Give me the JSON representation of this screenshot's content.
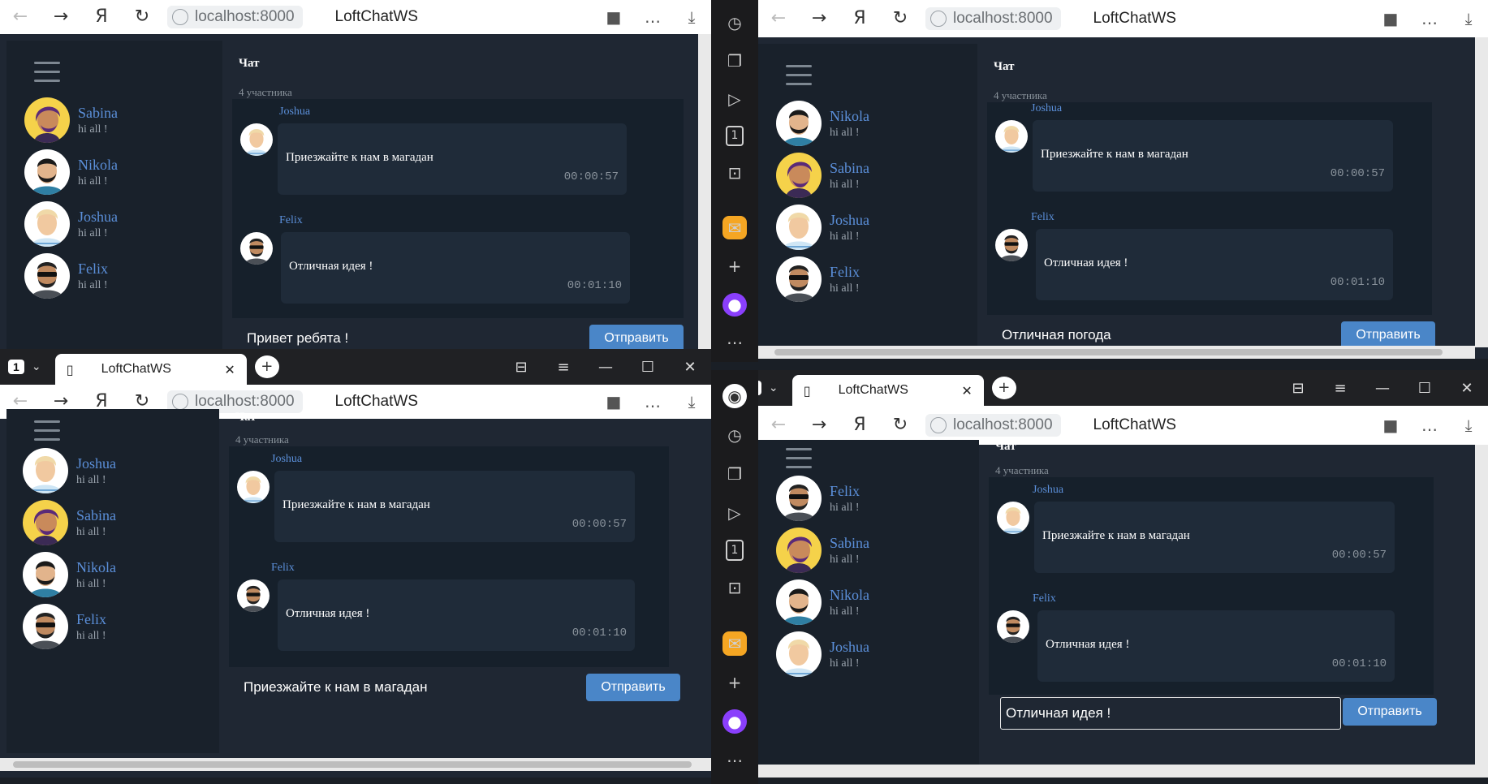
{
  "browser": {
    "address": "localhost:8000",
    "page_title": "LoftChatWS",
    "tab_title": "LoftChatWS",
    "tab_count": "1"
  },
  "chat": {
    "title": "Чат",
    "members_count": "4 участника",
    "send_label": "Отправить",
    "user_last_message": "hi all !",
    "messages": [
      {
        "author": "Joshua",
        "text": "Приезжайте к нам в магадан",
        "time": "00:00:57"
      },
      {
        "author": "Felix",
        "text": "Отличная идея !",
        "time": "00:01:10"
      }
    ]
  },
  "windows": [
    {
      "users": [
        "Sabina",
        "Nikola",
        "Joshua",
        "Felix"
      ],
      "input": "Привет ребята !"
    },
    {
      "users": [
        "Nikola",
        "Sabina",
        "Joshua",
        "Felix"
      ],
      "input": "Отличная погода"
    },
    {
      "users": [
        "Joshua",
        "Sabina",
        "Nikola",
        "Felix"
      ],
      "input": "Приезжайте к нам в магадан"
    },
    {
      "users": [
        "Felix",
        "Sabina",
        "Nikola",
        "Joshua"
      ],
      "input": "Отличная идея !"
    }
  ],
  "colors": {
    "accent": "#4a86c8",
    "username": "#5b8fd9",
    "background": "#1f2733"
  },
  "avatars": {
    "Sabina": {
      "skin": "#c98a5b",
      "hair": "#5a2a78",
      "bg": "#f5d24a"
    },
    "Nikola": {
      "skin": "#e2b48c",
      "hair": "#1a1a1a",
      "bg": "#2f7fa3"
    },
    "Joshua": {
      "skin": "#f1c9a0",
      "hair": "#f0d9a8",
      "bg": "#cfe6f5"
    },
    "Felix": {
      "skin": "#c08a60",
      "hair": "#222222",
      "bg": "#8a8f96"
    }
  }
}
